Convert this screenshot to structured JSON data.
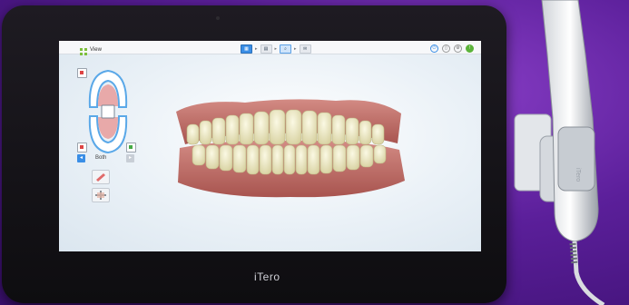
{
  "topbar": {
    "view_label": "View"
  },
  "left_panel": {
    "jaw_label": "Both"
  },
  "device": {
    "brand": "iTero"
  },
  "icons": [
    "view-grid-icon",
    "scan-step-icon",
    "chevron-right-icon",
    "settings-icon",
    "help-icon",
    "info-icon",
    "jaw-map-icon",
    "paint-tool-icon",
    "compare-tool-icon",
    "scanner-wand-icon"
  ],
  "colors": {
    "background_purple": "#5b1f9a",
    "accent_blue": "#3a8ee6",
    "accent_green": "#7cbf3c",
    "gum": "#c77a75",
    "teeth": "#f2efc9"
  }
}
